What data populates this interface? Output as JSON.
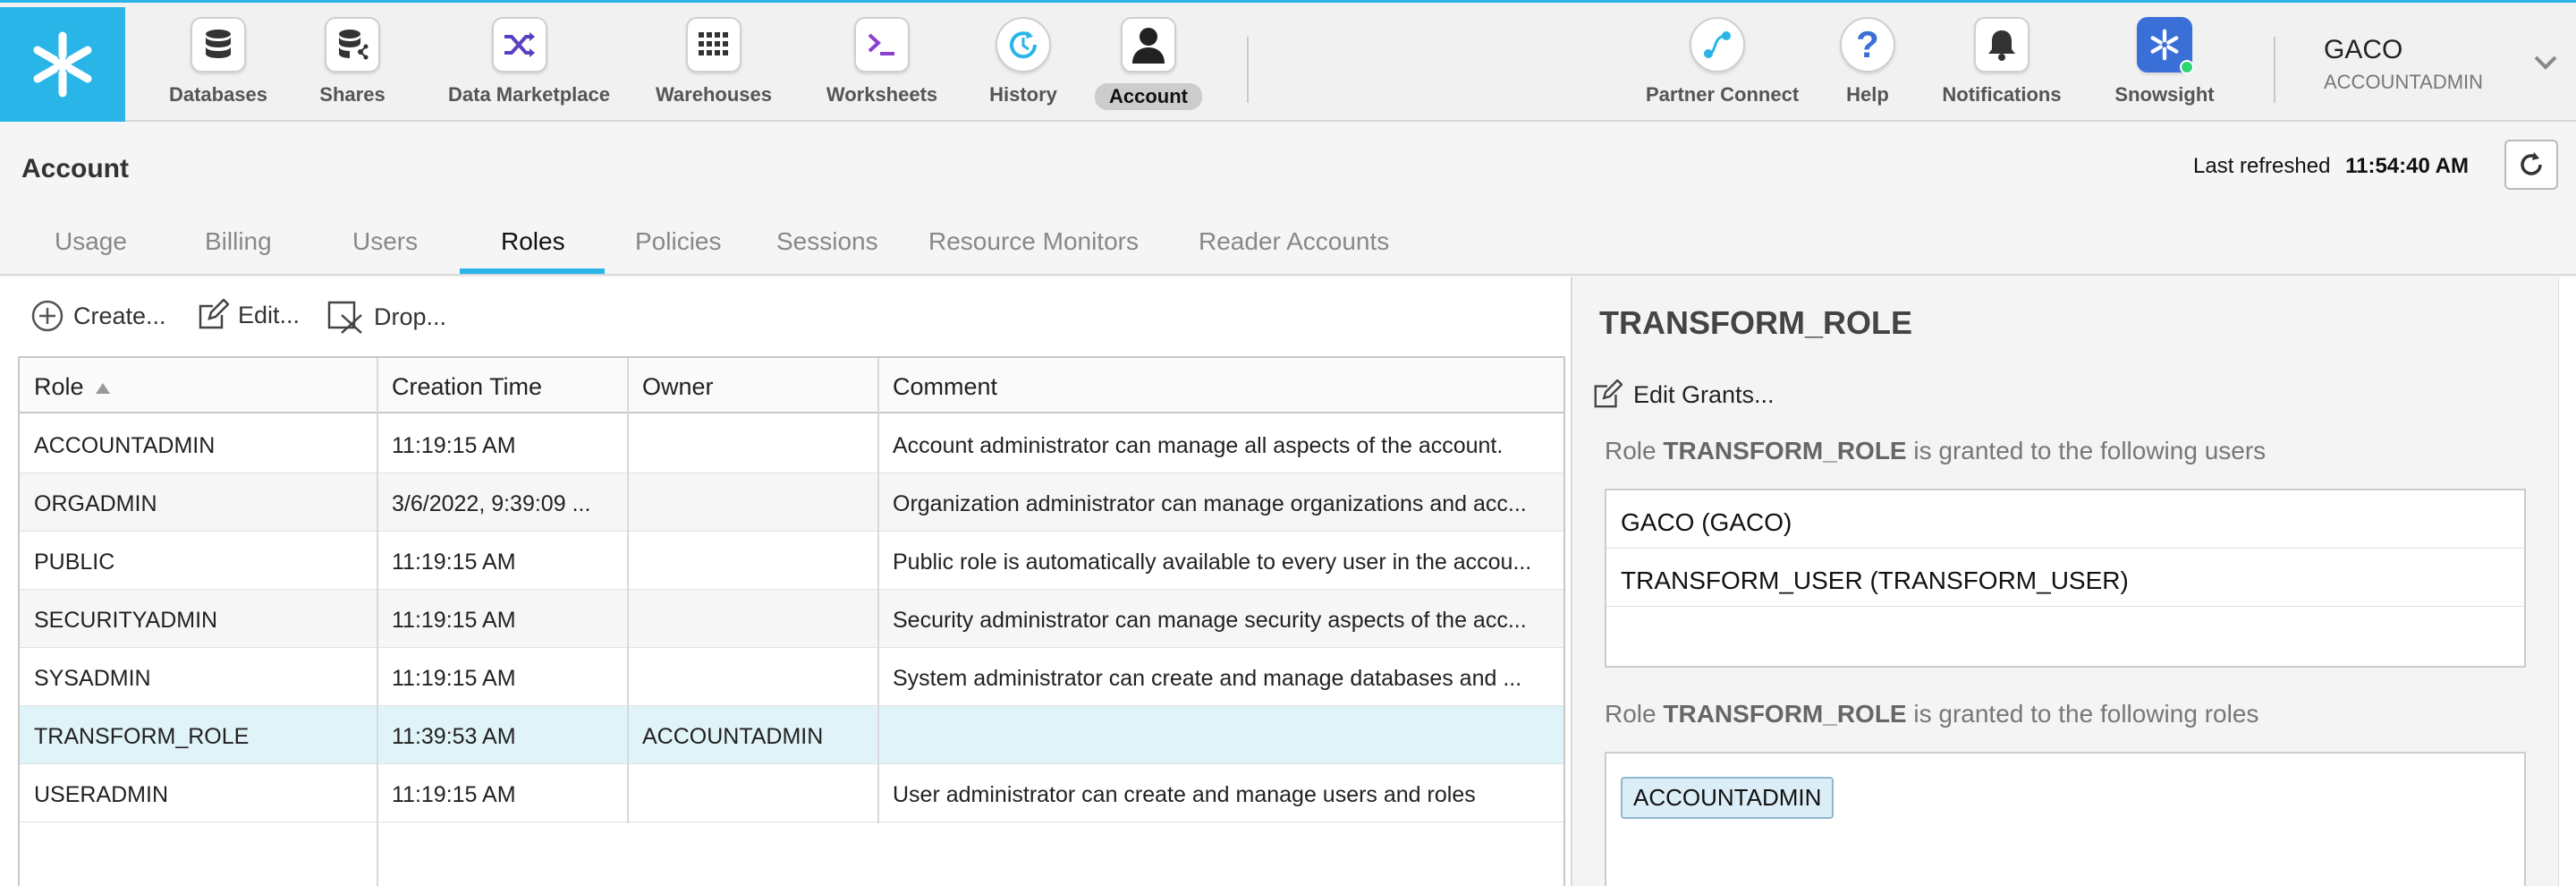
{
  "nav": {
    "items": [
      {
        "label": "Databases",
        "icon": "database-icon"
      },
      {
        "label": "Shares",
        "icon": "shares-icon"
      },
      {
        "label": "Data Marketplace",
        "icon": "shuffle-icon"
      },
      {
        "label": "Warehouses",
        "icon": "grid-icon"
      },
      {
        "label": "Worksheets",
        "icon": "terminal-icon"
      },
      {
        "label": "History",
        "icon": "history-icon"
      },
      {
        "label": "Account",
        "icon": "user-icon"
      }
    ],
    "right_items": [
      {
        "label": "Partner Connect",
        "icon": "partner-connect-icon"
      },
      {
        "label": "Help",
        "icon": "help-icon"
      },
      {
        "label": "Notifications",
        "icon": "bell-icon"
      },
      {
        "label": "Snowsight",
        "icon": "snowflake-icon"
      }
    ],
    "user_name": "GACO",
    "user_role": "ACCOUNTADMIN"
  },
  "header": {
    "title": "Account",
    "last_refreshed_label": "Last refreshed",
    "last_refreshed_time": "11:54:40 AM"
  },
  "tabs": [
    "Usage",
    "Billing",
    "Users",
    "Roles",
    "Policies",
    "Sessions",
    "Resource Monitors",
    "Reader Accounts"
  ],
  "actions": {
    "create": "Create...",
    "edit": "Edit...",
    "drop": "Drop..."
  },
  "table": {
    "columns": [
      "Role",
      "Creation Time",
      "Owner",
      "Comment"
    ],
    "rows": [
      {
        "role": "ACCOUNTADMIN",
        "time": "11:19:15 AM",
        "owner": "",
        "comment": "Account administrator can manage all aspects of the account."
      },
      {
        "role": "ORGADMIN",
        "time": "3/6/2022, 9:39:09 ...",
        "owner": "",
        "comment": "Organization administrator can manage organizations and acc..."
      },
      {
        "role": "PUBLIC",
        "time": "11:19:15 AM",
        "owner": "",
        "comment": "Public role is automatically available to every user in the accou..."
      },
      {
        "role": "SECURITYADMIN",
        "time": "11:19:15 AM",
        "owner": "",
        "comment": "Security administrator can manage security aspects of the acc..."
      },
      {
        "role": "SYSADMIN",
        "time": "11:19:15 AM",
        "owner": "",
        "comment": "System administrator can create and manage databases and ..."
      },
      {
        "role": "TRANSFORM_ROLE",
        "time": "11:39:53 AM",
        "owner": "ACCOUNTADMIN",
        "comment": ""
      },
      {
        "role": "USERADMIN",
        "time": "11:19:15 AM",
        "owner": "",
        "comment": "User administrator can create and manage users and roles"
      }
    ]
  },
  "detail": {
    "title": "TRANSFORM_ROLE",
    "edit_grants": "Edit Grants...",
    "users_prefix": "Role",
    "users_role": "TRANSFORM_ROLE",
    "users_suffix": "is granted to the following users",
    "users": [
      "GACO (GACO)",
      "TRANSFORM_USER (TRANSFORM_USER)"
    ],
    "roles_prefix": "Role",
    "roles_role": "TRANSFORM_ROLE",
    "roles_suffix": "is granted to the following roles",
    "roles": [
      "ACCOUNTADMIN"
    ]
  },
  "colors": {
    "accent": "#29b5e8",
    "selected_row": "#dff3f8"
  }
}
